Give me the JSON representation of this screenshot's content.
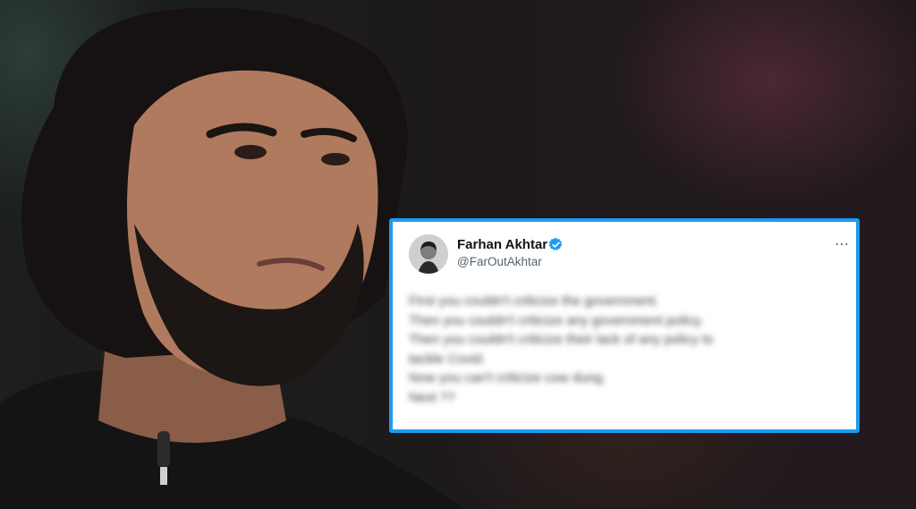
{
  "tweet": {
    "author_name": "Farhan Akhtar",
    "author_handle": "@FarOutAkhtar",
    "verified": true,
    "body_lines": [
      "First you couldn't criticize the government.",
      "Then you couldn't criticize any government policy.",
      "Then you couldn't criticize their lack of any policy to",
      "tackle Covid.",
      "Now you can't criticize cow dung.",
      "Next ??"
    ]
  },
  "colors": {
    "card_border": "#1d9bf0",
    "verified_badge": "#1d9bf0",
    "name_text": "#0f1419",
    "handle_text": "#536471"
  },
  "icons": {
    "verified": "verified-badge-icon",
    "more": "more-options-icon"
  }
}
